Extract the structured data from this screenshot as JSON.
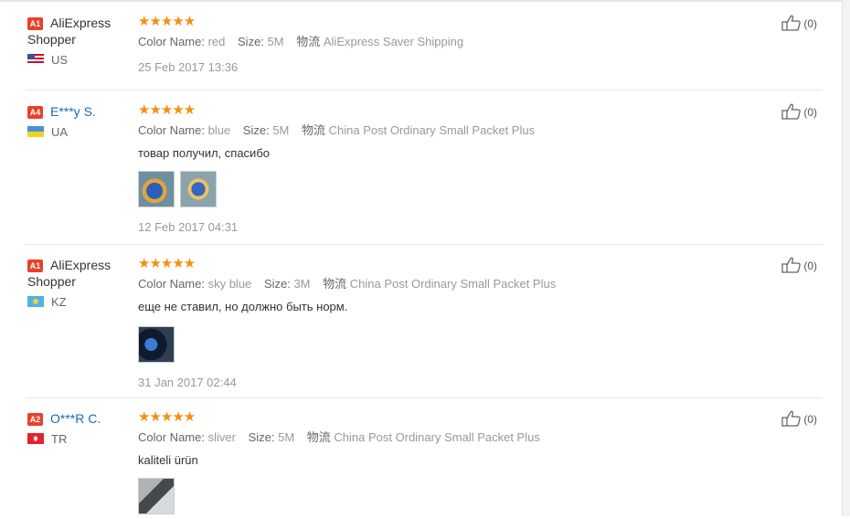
{
  "labels": {
    "color_name": "Color Name:",
    "size": "Size:",
    "shipping": "物流"
  },
  "stars_text": "★★★★★",
  "reviews": [
    {
      "badge": "A1",
      "buyer": "AliExpress Shopper",
      "country": "US",
      "rating": 5,
      "color": "red",
      "size": "5M",
      "shipping": "AliExpress Saver Shipping",
      "text": "",
      "photos": 0,
      "date": "25 Feb 2017 13:36",
      "useful": "(0)"
    },
    {
      "badge": "A4",
      "buyer": "E***y S.",
      "country": "UA",
      "rating": 5,
      "color": "blue",
      "size": "5M",
      "shipping": "China Post Ordinary Small Packet Plus",
      "text": "товар получил, спасибо",
      "photos": 2,
      "date": "12 Feb 2017 04:31",
      "useful": "(0)"
    },
    {
      "badge": "A1",
      "buyer": "AliExpress Shopper",
      "country": "KZ",
      "rating": 5,
      "color": "sky blue",
      "size": "3M",
      "shipping": "China Post Ordinary Small Packet Plus",
      "text": "еще не ставил, но должно быть норм.",
      "photos": 1,
      "date": "31 Jan 2017 02:44",
      "useful": "(0)"
    },
    {
      "badge": "A2",
      "buyer": "O***R C.",
      "country": "TR",
      "rating": 5,
      "color": "sliver",
      "size": "5M",
      "shipping": "China Post Ordinary Small Packet Plus",
      "text": "kaliteli ürün",
      "photos": 1,
      "date": "",
      "useful": "(0)"
    }
  ],
  "colors": {
    "badge": "#e8412b",
    "star": "#f58f0f",
    "link": "#1a6ab8"
  }
}
